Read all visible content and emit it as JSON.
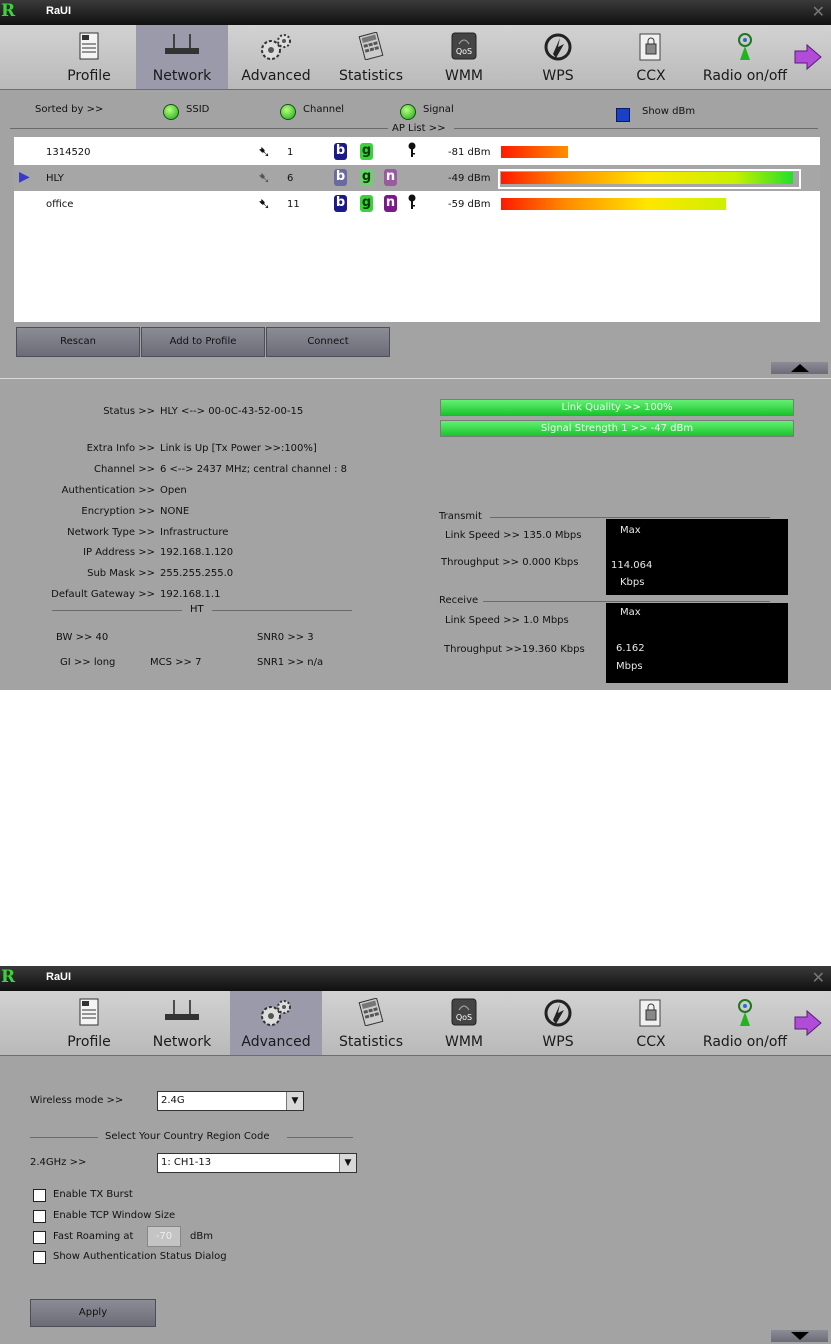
{
  "app": {
    "logo": "R",
    "title": "RaUI",
    "close": "✕"
  },
  "toolbar": {
    "items": [
      {
        "label": "Profile"
      },
      {
        "label": "Network"
      },
      {
        "label": "Advanced"
      },
      {
        "label": "Statistics"
      },
      {
        "label": "WMM"
      },
      {
        "label": "WPS"
      },
      {
        "label": "CCX"
      },
      {
        "label": "Radio on/off"
      }
    ]
  },
  "network": {
    "sorted_by": "Sorted by >>",
    "sort_ssid": "SSID",
    "sort_channel": "Channel",
    "sort_signal": "Signal",
    "show_dbm": "Show dBm",
    "ap_list_label": "AP List >>",
    "ap_list": [
      {
        "ssid": "1314520",
        "channel": "1",
        "modes": [
          "b",
          "g"
        ],
        "secured": true,
        "dbm": "-81 dBm",
        "strength": 0.23
      },
      {
        "ssid": "HLY",
        "channel": "6",
        "modes": [
          "b",
          "g",
          "n"
        ],
        "secured": false,
        "dbm": "-49 dBm",
        "strength": 1.0
      },
      {
        "ssid": "office",
        "channel": "11",
        "modes": [
          "b",
          "g",
          "n"
        ],
        "secured": true,
        "dbm": "-59 dBm",
        "strength": 0.77
      }
    ],
    "buttons": {
      "rescan": "Rescan",
      "add_to_profile": "Add to Profile",
      "connect": "Connect"
    },
    "status": {
      "status_label": "Status >>",
      "status_value": "HLY <--> 00-0C-43-52-00-15",
      "extra_label": "Extra Info >>",
      "extra_value": "Link is Up [Tx Power >>:100%]",
      "channel_label": "Channel >>",
      "channel_value": "6 <--> 2437 MHz; central channel : 8",
      "auth_label": "Authentication >>",
      "auth_value": "Open",
      "enc_label": "Encryption >>",
      "enc_value": "NONE",
      "nettype_label": "Network Type >>",
      "nettype_value": "Infrastructure",
      "ip_label": "IP Address >>",
      "ip_value": "192.168.1.120",
      "mask_label": "Sub Mask >>",
      "mask_value": "255.255.255.0",
      "gw_label": "Default Gateway >>",
      "gw_value": "192.168.1.1",
      "ht_label": "HT",
      "bw": "BW >>  40",
      "gi": "GI >> long",
      "mcs": "MCS >>  7",
      "snr0": "SNR0 >>  3",
      "snr1": "SNR1 >> n/a"
    },
    "link_quality": "Link Quality >> 100%",
    "signal_strength": "Signal Strength 1 >> -47 dBm",
    "transmit": {
      "header": "Transmit",
      "link_speed": "Link Speed >>  135.0 Mbps",
      "throughput": "Throughput >> 0.000 Kbps",
      "max": "Max",
      "value": "114.064",
      "unit": "Kbps"
    },
    "receive": {
      "header": "Receive",
      "link_speed": "Link Speed >> 1.0 Mbps",
      "throughput": "Throughput >>19.360 Kbps",
      "max": "Max",
      "value": "6.162",
      "unit": "Mbps"
    }
  },
  "advanced": {
    "wireless_mode_label": "Wireless mode >>",
    "wireless_mode_value": "2.4G",
    "country_header": "Select Your Country Region Code",
    "band_label": "2.4GHz >>",
    "band_value": "1: CH1-13",
    "opt_tx_burst": "Enable TX Burst",
    "opt_tcp_window": "Enable TCP Window Size",
    "opt_fast_roaming": "Fast Roaming at",
    "fast_roaming_value": "-70",
    "fast_roaming_unit": "dBm",
    "opt_auth_dialog": "Show Authentication Status Dialog",
    "apply": "Apply"
  }
}
